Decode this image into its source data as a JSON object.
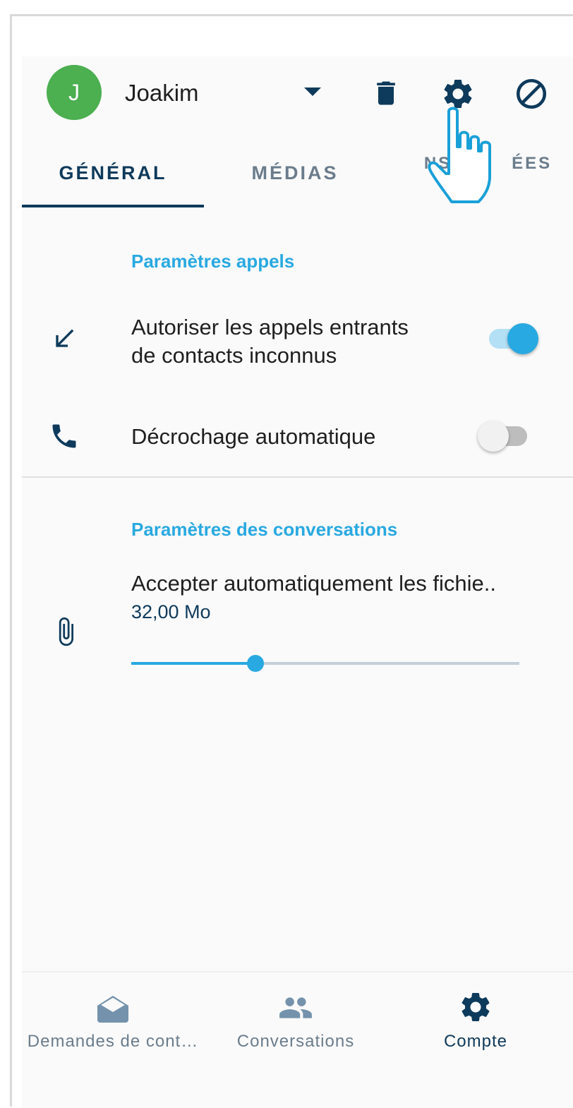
{
  "account": {
    "initial": "J",
    "name": "Joakim"
  },
  "toolbar": {
    "icons": [
      "dropdown-icon",
      "trash-icon",
      "gear-icon",
      "block-icon"
    ]
  },
  "tabs": [
    {
      "label": "GÉNÉRAL",
      "active": true
    },
    {
      "label": "MÉDIAS",
      "active": false
    },
    {
      "label": "NS AV    ÉES",
      "active": false
    }
  ],
  "calls": {
    "section_title": "Paramètres appels",
    "incoming_label_line1": "Autoriser les appels entrants",
    "incoming_label_line2": "de contacts inconnus",
    "incoming_enabled": true,
    "autoanswer_label": "Décrochage automatique",
    "autoanswer_enabled": false
  },
  "conversations": {
    "section_title": "Paramètres des conversations",
    "autoaccept_label": "Accepter automatiquement les fichie..",
    "autoaccept_value": "32,00 Mo",
    "autoaccept_level": 0.32
  },
  "bottom_nav": [
    {
      "label": "Demandes de cont…",
      "icon": "mail-open-icon",
      "active": false
    },
    {
      "label": "Conversations",
      "icon": "people-icon",
      "active": false
    },
    {
      "label": "Compte",
      "icon": "gear-icon",
      "active": true
    }
  ],
  "colors": {
    "accent": "#29a9e1",
    "primary_dark": "#0e3a5b",
    "avatar": "#4caf50",
    "inactive": "#6b7d8c"
  }
}
